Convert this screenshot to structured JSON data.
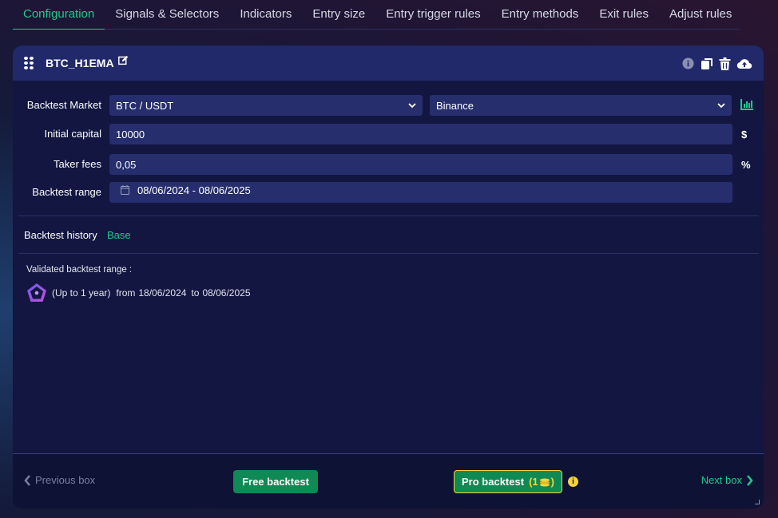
{
  "tabs": [
    {
      "label": "Configuration",
      "active": true
    },
    {
      "label": "Signals & Selectors"
    },
    {
      "label": "Indicators"
    },
    {
      "label": "Entry size"
    },
    {
      "label": "Entry trigger rules"
    },
    {
      "label": "Entry methods"
    },
    {
      "label": "Exit rules"
    },
    {
      "label": "Adjust rules"
    }
  ],
  "card": {
    "title": "BTC_H1EMA",
    "header_icons": [
      "info-icon",
      "duplicate-icon",
      "trash-icon",
      "cloud-upload-icon"
    ]
  },
  "form": {
    "market_label": "Backtest Market",
    "market_pair": "BTC / USDT",
    "exchange": "Binance",
    "capital_label": "Initial capital",
    "capital_value": "10000",
    "capital_unit": "$",
    "fees_label": "Taker fees",
    "fees_value": "0,05",
    "fees_unit": "%",
    "range_label": "Backtest range",
    "range_value": "08/06/2024 - 08/06/2025"
  },
  "history": {
    "label": "Backtest history",
    "value": "Base"
  },
  "validated": {
    "title": "Validated backtest range :",
    "limit": "(Up to 1 year)",
    "from_label": "from",
    "from_date": "18/06/2024",
    "to_label": "to",
    "to_date": "08/06/2025"
  },
  "footer": {
    "prev_label": "Previous box",
    "next_label": "Next box",
    "free_label": "Free backtest",
    "pro_label": "Pro backtest",
    "pro_cost_open": "(1",
    "pro_cost_close": ")",
    "info": "i"
  },
  "colors": {
    "accent": "#21c98d",
    "gold": "#f6d33b",
    "card": "#121641",
    "header": "#21296a",
    "field": "#262e6d"
  }
}
